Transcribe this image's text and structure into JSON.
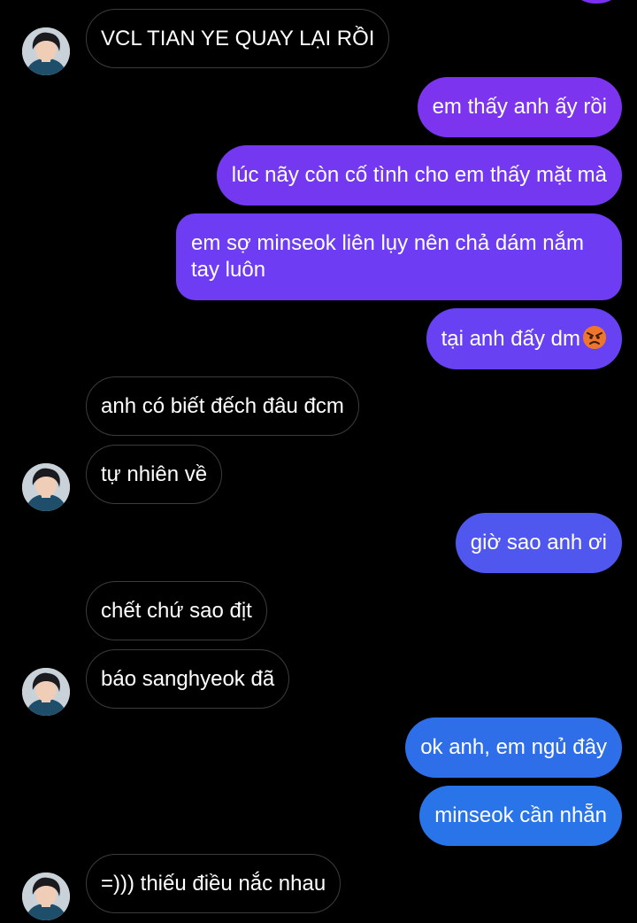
{
  "conversation": {
    "messages": [
      {
        "side": "in",
        "text": "VCL TIAN YE QUAY LẠI RỒI"
      },
      {
        "side": "out",
        "text": "em thấy anh ấy rồi",
        "color": "#7c34ee"
      },
      {
        "side": "out",
        "text": "lúc nãy còn cố tình cho em thấy mặt mà",
        "color": "#7438f0"
      },
      {
        "side": "out",
        "text": "em sợ minseok liên lụy nên chả dám nắm tay luôn",
        "color": "#6e3cf2"
      },
      {
        "side": "out",
        "text": "tại anh đấy dm",
        "emoji": "angry-face",
        "color": "#6841f3"
      },
      {
        "side": "in",
        "text": "anh có biết đếch đâu đcm"
      },
      {
        "side": "in",
        "text": "tự nhiên về"
      },
      {
        "side": "out",
        "text": "giờ sao anh ơi",
        "color": "#4f57ee"
      },
      {
        "side": "in",
        "text": "chết chứ sao địt"
      },
      {
        "side": "in",
        "text": "báo sanghyeok đã"
      },
      {
        "side": "out",
        "text": "ok anh, em ngủ đây",
        "color": "#2f6ee9"
      },
      {
        "side": "out",
        "text": "minseok cần nhẵn",
        "color": "#2a74ea"
      },
      {
        "side": "in",
        "text": "=))) thiếu điều nắc nhau"
      }
    ]
  },
  "avatar": {
    "icon": "contact-avatar",
    "background": "#cfd6dc"
  }
}
